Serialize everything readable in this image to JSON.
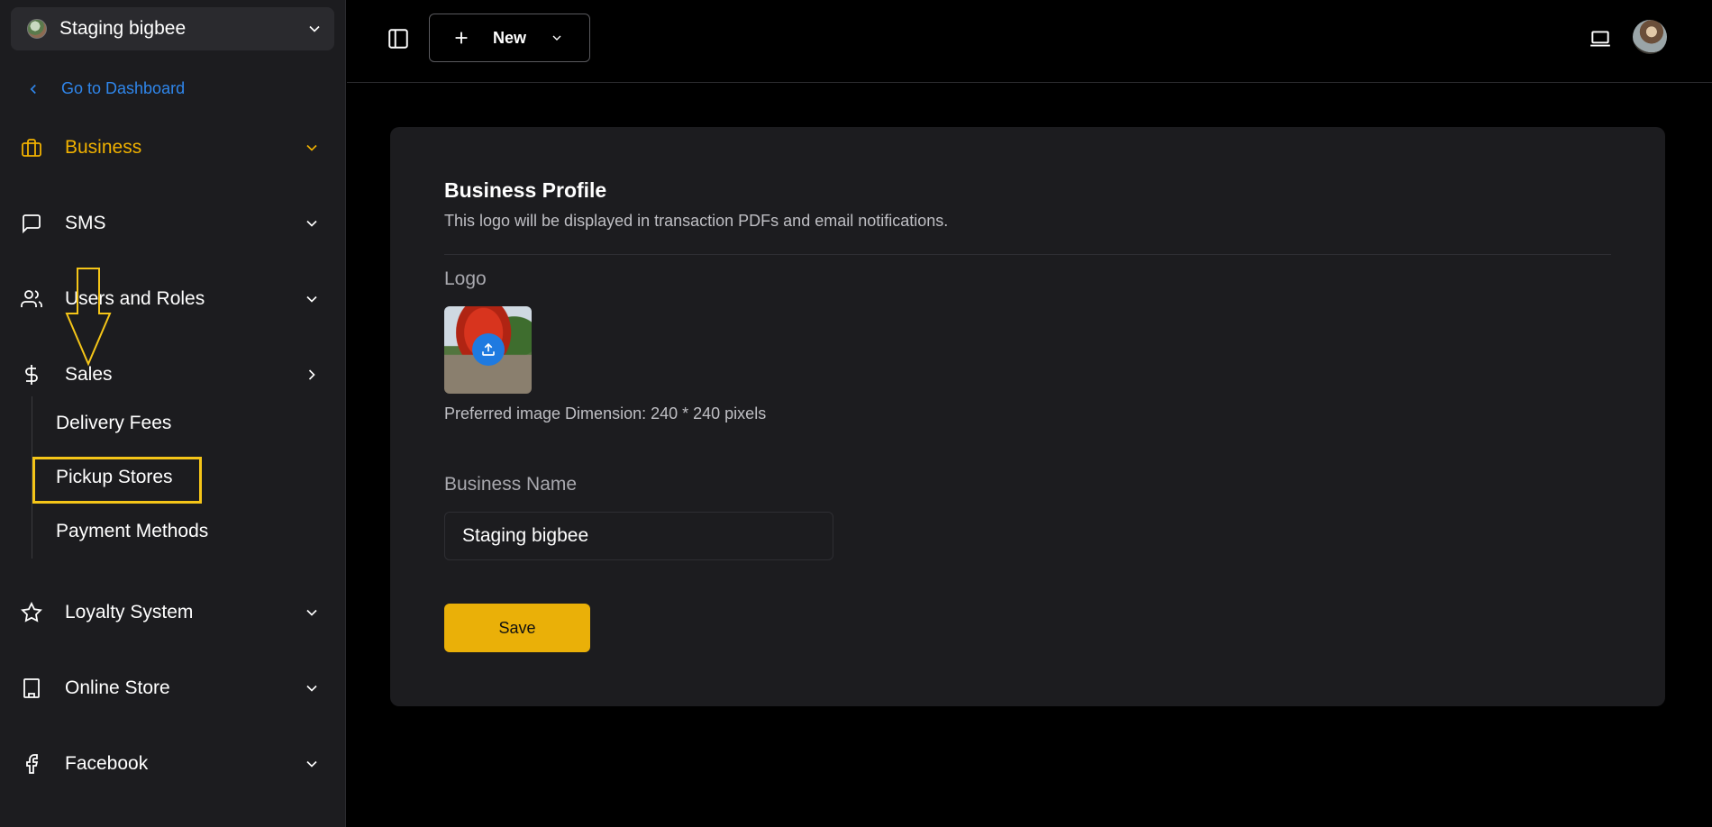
{
  "workspace": {
    "name": "Staging bigbee"
  },
  "sidebar": {
    "back_link": "Go to Dashboard",
    "items": [
      {
        "label": "Business",
        "icon": "briefcase-icon",
        "active": true
      },
      {
        "label": "SMS",
        "icon": "message-icon"
      },
      {
        "label": "Users and Roles",
        "icon": "users-icon"
      },
      {
        "label": "Sales",
        "icon": "dollar-icon"
      },
      {
        "label": "Loyalty System",
        "icon": "star-icon"
      },
      {
        "label": "Online Store",
        "icon": "building-icon"
      },
      {
        "label": "Facebook",
        "icon": "facebook-icon"
      }
    ],
    "sales_subitems": [
      {
        "label": "Delivery Fees"
      },
      {
        "label": "Pickup Stores",
        "highlighted": true
      },
      {
        "label": "Payment Methods"
      }
    ]
  },
  "topbar": {
    "new_label": "New"
  },
  "profile": {
    "title": "Business Profile",
    "subtitle": "This logo will be displayed in transaction PDFs and email notifications.",
    "logo_label": "Logo",
    "preferred_dimension": "Preferred image Dimension: 240 * 240 pixels",
    "name_label": "Business Name",
    "name_value": "Staging bigbee",
    "save_label": "Save"
  },
  "colors": {
    "accent": "#eab008",
    "link": "#2f86eb",
    "annotation": "#f5c518"
  }
}
